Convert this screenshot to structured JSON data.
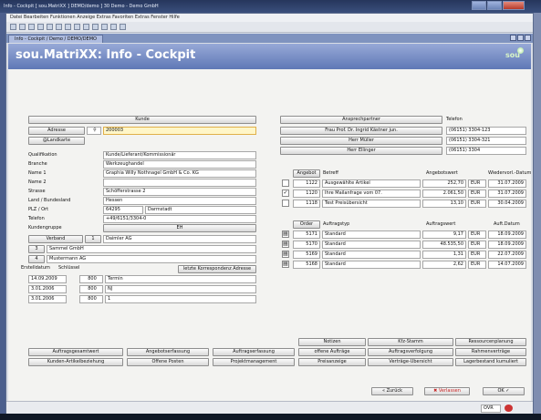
{
  "window": {
    "title": "Info - Cockpit [ sou.MatriXX ] DEMO/demo ] 30 Demo - Demo GmbH"
  },
  "menu": {
    "text": "Datei  Bearbeiten  Funktionen  Anzeige  Extras  Favoriten  Extras  Fenster  Hilfe"
  },
  "tab": {
    "label": "Info - Cockpit / Demo / DEMO/DEMO"
  },
  "header": {
    "title": "sou.MatriXX: Info - Cockpit",
    "logo": "sou"
  },
  "kunde": {
    "section_label": "Kunde",
    "adresse_label": "Adresse",
    "adresse_value": "200003",
    "landkarte_label": "@Landkarte",
    "fields": [
      {
        "label": "Qualifikation",
        "value": "Kunde/Lieferant/Kommissionär"
      },
      {
        "label": "Branche",
        "value": "Werkzeughandel"
      },
      {
        "label": "Name 1",
        "value": "Graphia Willy Nothnagel GmbH & Co. KG"
      },
      {
        "label": "Name 2",
        "value": ""
      },
      {
        "label": "Strasse",
        "value": "Schöfferstrasse 2"
      },
      {
        "label": "Land / Bundesland",
        "value": "Hessen"
      },
      {
        "label": "PLZ / Ort",
        "value": "64295",
        "value2": "Darmstadt"
      },
      {
        "label": "Telefon",
        "value": "+49/6151/3304-0"
      }
    ],
    "kundengruppe_label": "Kundengruppe",
    "kundengruppe_value": "EH",
    "verband": {
      "label": "Verband",
      "nr": "1",
      "name": "Daimler AG"
    },
    "related": [
      {
        "nr": "3",
        "name": "Sammel GmbH"
      },
      {
        "nr": "4",
        "name": "Mustermann AG"
      }
    ],
    "notes_header": {
      "date": "Erstelldatum",
      "key": "Schlüssel"
    },
    "korrespondenz_button": "letzte Korrespondenz Adresse",
    "notes": [
      {
        "date": "14.09.2009",
        "key": "800",
        "text": "Termin"
      },
      {
        "date": "3.01.2006",
        "key": "800",
        "text": "NJ"
      },
      {
        "date": "3.01.2006",
        "key": "800",
        "text": "1"
      }
    ]
  },
  "contacts": {
    "header_button": "Ansprechpartner",
    "phone_header": "Telefon",
    "rows": [
      {
        "name": "Frau Prof. Dr. Ingrid Kästner jun.",
        "phone": "(06151) 3304-123"
      },
      {
        "name": "Herr Müller",
        "phone": "(06151) 3304-321"
      },
      {
        "name": "Herr Ellinger",
        "phone": "(06151) 3304"
      }
    ]
  },
  "offers": {
    "button": "Angebot",
    "cols": {
      "betreff": "Betreff",
      "wert": "Angebotswert",
      "datum": "Wiedervorl.-Datum"
    },
    "rows": [
      {
        "check": "",
        "nr": "1122",
        "betreff": "Ausgewählte Artikel",
        "wert": "252,70",
        "cur": "EUR",
        "datum": "31.07.2009"
      },
      {
        "check": "✓",
        "nr": "1120",
        "betreff": "Ihre Mailanfrage vom 07.",
        "wert": "2.061,50",
        "cur": "EUR",
        "datum": "31.07.2009"
      },
      {
        "check": "",
        "nr": "1118",
        "betreff": "Test Preisübersicht",
        "wert": "13,10",
        "cur": "EUR",
        "datum": "30.04.2009"
      }
    ]
  },
  "orders": {
    "button": "Order",
    "cols": {
      "typ": "Auftragstyp",
      "wert": "Auftragswert",
      "datum": "Auft.Datum"
    },
    "rows": [
      {
        "nr": "5171",
        "typ": "Standard",
        "wert": "9,17",
        "cur": "EUR",
        "datum": "18.09.2009"
      },
      {
        "nr": "5170",
        "typ": "Standard",
        "wert": "48.535,50",
        "cur": "EUR",
        "datum": "18.09.2009"
      },
      {
        "nr": "5169",
        "typ": "Standard",
        "wert": "1,31",
        "cur": "EUR",
        "datum": "22.07.2009"
      },
      {
        "nr": "5168",
        "typ": "Standard",
        "wert": "2,62",
        "cur": "EUR",
        "datum": "14.07.2009"
      }
    ]
  },
  "action_buttons": {
    "row1": [
      "Notizen",
      "Kfz-Stamm",
      "Ressourcenplanung"
    ],
    "row2": [
      "Auftragsgesamtwert",
      "Angebotserfassung",
      "Auftragserfassung",
      "offene Aufträge",
      "Auftragsverfolgung",
      "Rahmenverträge"
    ],
    "row3": [
      "Kunden-Artikelbeziehung",
      "Offene Posten",
      "Projektmanagement",
      "Preisanzeige",
      "Verträge-Übersicht",
      "Lagerbestand kumuliert"
    ]
  },
  "footer": {
    "back": "« Zurück",
    "discard": "✖ Verlassen",
    "ok": "OK ✓"
  },
  "status": {
    "text": "OVR"
  }
}
